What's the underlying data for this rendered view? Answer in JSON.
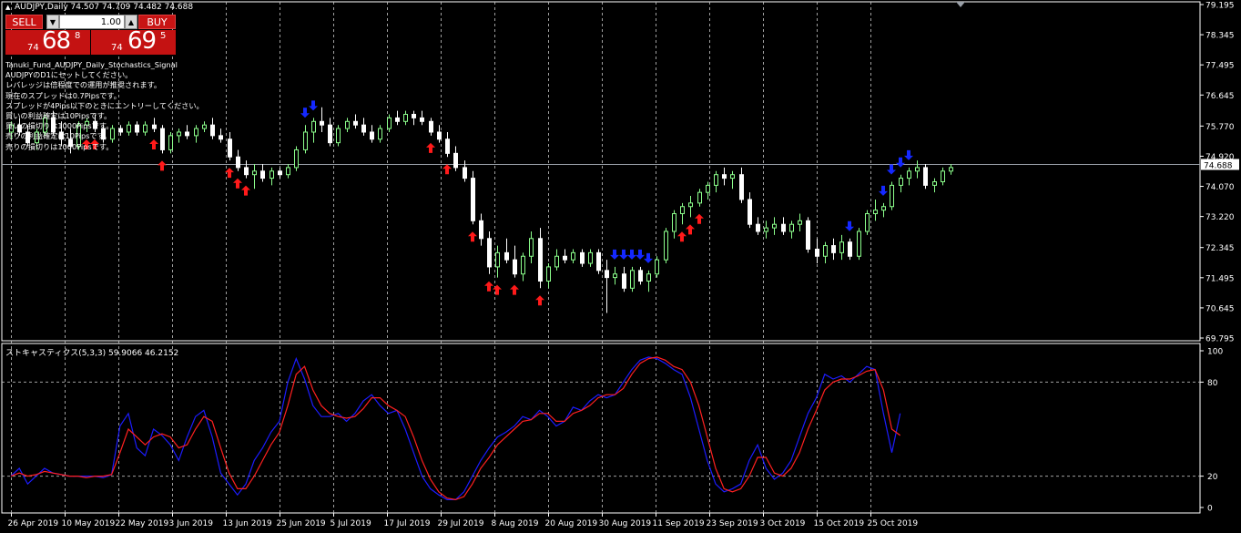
{
  "window": {
    "title": "AUDJPY,Daily  74.507 74.709 74.482 74.688",
    "symbol": "AUDJPY",
    "timeframe": "Daily"
  },
  "trade_panel": {
    "sell_label": "SELL",
    "buy_label": "BUY",
    "lot_value": "1.00",
    "lot_down_icon": "triangle-down-icon",
    "lot_up_icon": "triangle-up-icon",
    "sell_price": {
      "prefix": "74",
      "big": "68",
      "sup": "8"
    },
    "buy_price": {
      "prefix": "74",
      "big": "69",
      "sup": "5"
    }
  },
  "indicator_info": {
    "lines": [
      "Tanuki_Fund_AUDJPY_Daily_Stochastics_Signal",
      "AUDJPYのD1にセットしてください。",
      "レバレッジは倍程度での運用が推奨されます。",
      "現在のスプレッドは0.7Pipsです。",
      "スプレッドが4Pips以下のときにエントリーしてください。",
      "買いの利益確定は10Pipsです。",
      "買いの損切りは1000Pipsです。",
      "売りの利益確定は10Pipsです。",
      "売りの損切りは1000Pipsです。"
    ]
  },
  "stochastic": {
    "title": "ストキャスティクス(5,3,3) 59.9066 46.2152",
    "levels": [
      100,
      80,
      20,
      0
    ],
    "main_color": "#1c1cff",
    "signal_color": "#ff2020"
  },
  "price_axis": {
    "labels": [
      "79.195",
      "78.345",
      "77.495",
      "76.645",
      "75.770",
      "74.920",
      "74.070",
      "73.220",
      "72.345",
      "71.495",
      "70.645",
      "69.795"
    ],
    "current_price": "74.688"
  },
  "time_axis": {
    "labels": [
      "26 Apr 2019",
      "10 May 2019",
      "22 May 2019",
      "3 Jun 2019",
      "13 Jun 2019",
      "25 Jun 2019",
      "5 Jul 2019",
      "17 Jul 2019",
      "29 Jul 2019",
      "8 Aug 2019",
      "20 Aug 2019",
      "30 Aug 2019",
      "11 Sep 2019",
      "23 Sep 2019",
      "3 Oct 2019",
      "15 Oct 2019",
      "25 Oct 2019"
    ]
  },
  "colors": {
    "background": "#000000",
    "bull_candle": "#8cff8c",
    "bear_candle": "#ffffff",
    "grid": "#c8c8c8",
    "buy_arrow": "#ff1a1a",
    "sell_arrow": "#1428ff",
    "axis": "#ffffff"
  },
  "chart_data": {
    "type": "candlestick",
    "price_range": [
      69.795,
      79.195
    ],
    "candles": [
      [
        75.6,
        75.9,
        75.4,
        75.8
      ],
      [
        75.8,
        76.0,
        75.5,
        75.6
      ],
      [
        75.6,
        75.8,
        75.2,
        75.3
      ],
      [
        75.3,
        75.7,
        75.1,
        75.6
      ],
      [
        75.6,
        76.1,
        75.5,
        76.0
      ],
      [
        76.0,
        76.2,
        75.5,
        75.6
      ],
      [
        75.6,
        75.9,
        75.2,
        75.4
      ],
      [
        75.4,
        75.7,
        75.0,
        75.2
      ],
      [
        75.2,
        75.9,
        75.1,
        75.8
      ],
      [
        75.8,
        76.0,
        75.6,
        75.9
      ],
      [
        75.9,
        76.1,
        75.6,
        75.7
      ],
      [
        75.7,
        75.8,
        75.3,
        75.4
      ],
      [
        75.4,
        75.8,
        75.3,
        75.7
      ],
      [
        75.7,
        75.8,
        75.5,
        75.6
      ],
      [
        75.6,
        75.9,
        75.5,
        75.8
      ],
      [
        75.8,
        75.9,
        75.5,
        75.6
      ],
      [
        75.6,
        75.9,
        75.5,
        75.8
      ],
      [
        75.8,
        76.0,
        75.6,
        75.7
      ],
      [
        75.7,
        75.8,
        75.0,
        75.1
      ],
      [
        75.1,
        75.6,
        75.0,
        75.5
      ],
      [
        75.5,
        75.7,
        75.3,
        75.6
      ],
      [
        75.6,
        75.8,
        75.4,
        75.5
      ],
      [
        75.5,
        75.8,
        75.3,
        75.7
      ],
      [
        75.7,
        75.9,
        75.6,
        75.8
      ],
      [
        75.8,
        76.0,
        75.4,
        75.5
      ],
      [
        75.5,
        75.7,
        75.3,
        75.4
      ],
      [
        75.4,
        75.6,
        74.8,
        74.9
      ],
      [
        74.9,
        75.1,
        74.5,
        74.6
      ],
      [
        74.6,
        74.8,
        74.3,
        74.4
      ],
      [
        74.4,
        74.7,
        74.0,
        74.5
      ],
      [
        74.5,
        74.7,
        74.2,
        74.3
      ],
      [
        74.3,
        74.6,
        74.1,
        74.5
      ],
      [
        74.5,
        74.6,
        74.3,
        74.4
      ],
      [
        74.4,
        74.7,
        74.3,
        74.6
      ],
      [
        74.6,
        75.2,
        74.5,
        75.1
      ],
      [
        75.1,
        75.8,
        75.0,
        75.6
      ],
      [
        75.6,
        76.0,
        75.3,
        75.9
      ],
      [
        75.9,
        76.3,
        75.6,
        75.8
      ],
      [
        75.8,
        76.0,
        75.2,
        75.3
      ],
      [
        75.3,
        75.8,
        75.2,
        75.7
      ],
      [
        75.7,
        76.0,
        75.6,
        75.9
      ],
      [
        75.9,
        76.1,
        75.7,
        75.8
      ],
      [
        75.8,
        76.0,
        75.5,
        75.6
      ],
      [
        75.6,
        75.8,
        75.3,
        75.4
      ],
      [
        75.4,
        75.8,
        75.3,
        75.7
      ],
      [
        75.7,
        76.1,
        75.6,
        76.0
      ],
      [
        76.0,
        76.2,
        75.8,
        75.9
      ],
      [
        75.9,
        76.2,
        75.8,
        76.1
      ],
      [
        76.1,
        76.2,
        75.8,
        76.0
      ],
      [
        76.0,
        76.2,
        75.8,
        75.9
      ],
      [
        75.9,
        76.0,
        75.5,
        75.6
      ],
      [
        75.6,
        75.8,
        75.3,
        75.4
      ],
      [
        75.4,
        75.6,
        74.9,
        75.0
      ],
      [
        75.0,
        75.2,
        74.5,
        74.6
      ],
      [
        74.6,
        74.8,
        74.2,
        74.3
      ],
      [
        74.3,
        74.5,
        73.0,
        73.1
      ],
      [
        73.1,
        73.3,
        72.4,
        72.6
      ],
      [
        72.6,
        72.8,
        71.6,
        71.8
      ],
      [
        71.8,
        72.4,
        71.5,
        72.2
      ],
      [
        72.2,
        72.6,
        71.9,
        72.0
      ],
      [
        72.0,
        72.4,
        71.5,
        71.6
      ],
      [
        71.6,
        72.2,
        71.4,
        72.1
      ],
      [
        72.1,
        72.8,
        71.9,
        72.6
      ],
      [
        72.6,
        72.9,
        71.2,
        71.4
      ],
      [
        71.4,
        71.9,
        71.2,
        71.8
      ],
      [
        71.8,
        72.3,
        71.7,
        72.1
      ],
      [
        72.1,
        72.3,
        71.9,
        72.0
      ],
      [
        72.0,
        72.3,
        71.9,
        72.2
      ],
      [
        72.2,
        72.3,
        71.8,
        71.9
      ],
      [
        71.9,
        72.3,
        71.8,
        72.2
      ],
      [
        72.2,
        72.3,
        71.6,
        71.7
      ],
      [
        71.7,
        72.0,
        70.5,
        71.5
      ],
      [
        71.5,
        71.8,
        71.3,
        71.6
      ],
      [
        71.6,
        71.8,
        71.1,
        71.2
      ],
      [
        71.2,
        71.8,
        71.1,
        71.7
      ],
      [
        71.7,
        71.8,
        71.3,
        71.4
      ],
      [
        71.4,
        71.7,
        71.1,
        71.6
      ],
      [
        71.6,
        72.1,
        71.5,
        72.0
      ],
      [
        72.0,
        72.9,
        71.9,
        72.8
      ],
      [
        72.8,
        73.4,
        72.6,
        73.3
      ],
      [
        73.3,
        73.6,
        73.0,
        73.5
      ],
      [
        73.5,
        73.8,
        73.2,
        73.6
      ],
      [
        73.6,
        74.0,
        73.5,
        73.9
      ],
      [
        73.9,
        74.2,
        73.7,
        74.1
      ],
      [
        74.1,
        74.5,
        73.9,
        74.4
      ],
      [
        74.4,
        74.6,
        74.1,
        74.3
      ],
      [
        74.3,
        74.5,
        74.0,
        74.4
      ],
      [
        74.4,
        74.6,
        73.6,
        73.7
      ],
      [
        73.7,
        73.9,
        72.9,
        73.0
      ],
      [
        73.0,
        73.2,
        72.7,
        72.8
      ],
      [
        72.8,
        73.1,
        72.6,
        72.9
      ],
      [
        72.9,
        73.2,
        72.7,
        73.0
      ],
      [
        73.0,
        73.2,
        72.7,
        72.8
      ],
      [
        72.8,
        73.1,
        72.6,
        73.0
      ],
      [
        73.0,
        73.3,
        72.8,
        73.1
      ],
      [
        73.1,
        73.2,
        72.2,
        72.3
      ],
      [
        72.3,
        72.6,
        71.9,
        72.1
      ],
      [
        72.1,
        72.5,
        71.9,
        72.4
      ],
      [
        72.4,
        72.6,
        72.0,
        72.2
      ],
      [
        72.2,
        72.7,
        72.0,
        72.5
      ],
      [
        72.5,
        72.6,
        72.0,
        72.1
      ],
      [
        72.1,
        72.9,
        72.0,
        72.8
      ],
      [
        72.8,
        73.4,
        72.7,
        73.3
      ],
      [
        73.3,
        73.7,
        73.1,
        73.4
      ],
      [
        73.4,
        73.6,
        73.2,
        73.5
      ],
      [
        73.5,
        74.2,
        73.4,
        74.1
      ],
      [
        74.1,
        74.4,
        73.9,
        74.3
      ],
      [
        74.3,
        74.6,
        74.1,
        74.5
      ],
      [
        74.5,
        74.8,
        74.3,
        74.6
      ],
      [
        74.6,
        74.7,
        74.0,
        74.1
      ],
      [
        74.1,
        74.3,
        73.9,
        74.2
      ],
      [
        74.2,
        74.6,
        74.1,
        74.5
      ],
      [
        74.5,
        74.7,
        74.4,
        74.6
      ]
    ],
    "buy_arrows_idx": [
      9,
      10,
      17,
      18,
      26,
      27,
      28,
      50,
      52,
      55,
      57,
      58,
      60,
      63,
      80,
      81,
      82
    ],
    "sell_arrows_idx": [
      35,
      36,
      72,
      73,
      74,
      75,
      76,
      100,
      104,
      105,
      106,
      107
    ],
    "stoch_main": [
      20,
      25,
      15,
      20,
      25,
      22,
      21,
      20,
      20,
      20,
      20,
      19,
      21,
      52,
      60,
      38,
      33,
      50,
      46,
      40,
      30,
      45,
      58,
      62,
      45,
      22,
      15,
      8,
      15,
      30,
      38,
      48,
      55,
      80,
      95,
      82,
      65,
      58,
      58,
      60,
      55,
      60,
      68,
      72,
      65,
      60,
      62,
      50,
      35,
      20,
      12,
      8,
      5,
      5,
      10,
      20,
      30,
      38,
      45,
      48,
      52,
      58,
      56,
      62,
      58,
      52,
      55,
      64,
      62,
      68,
      72,
      70,
      72,
      80,
      88,
      94,
      96,
      95,
      92,
      88,
      85,
      70,
      50,
      30,
      15,
      10,
      12,
      15,
      30,
      40,
      25,
      18,
      22,
      30,
      45,
      60,
      70,
      85,
      82,
      84,
      80,
      85,
      90,
      88,
      60,
      35,
      60
    ],
    "stoch_signal": [
      20,
      22,
      20,
      21,
      23,
      22,
      21,
      20,
      20,
      19,
      20,
      20,
      21,
      35,
      50,
      45,
      40,
      45,
      47,
      45,
      38,
      40,
      50,
      58,
      55,
      38,
      22,
      12,
      12,
      20,
      30,
      40,
      48,
      65,
      85,
      90,
      75,
      65,
      60,
      58,
      57,
      58,
      63,
      70,
      70,
      65,
      62,
      58,
      45,
      30,
      18,
      10,
      6,
      5,
      7,
      15,
      25,
      32,
      40,
      45,
      50,
      55,
      56,
      60,
      60,
      55,
      55,
      60,
      62,
      65,
      70,
      72,
      72,
      76,
      85,
      92,
      95,
      96,
      94,
      90,
      88,
      80,
      65,
      45,
      25,
      12,
      10,
      12,
      20,
      32,
      32,
      22,
      20,
      25,
      35,
      50,
      62,
      75,
      80,
      82,
      82,
      84,
      87,
      88,
      75,
      50,
      46
    ]
  }
}
